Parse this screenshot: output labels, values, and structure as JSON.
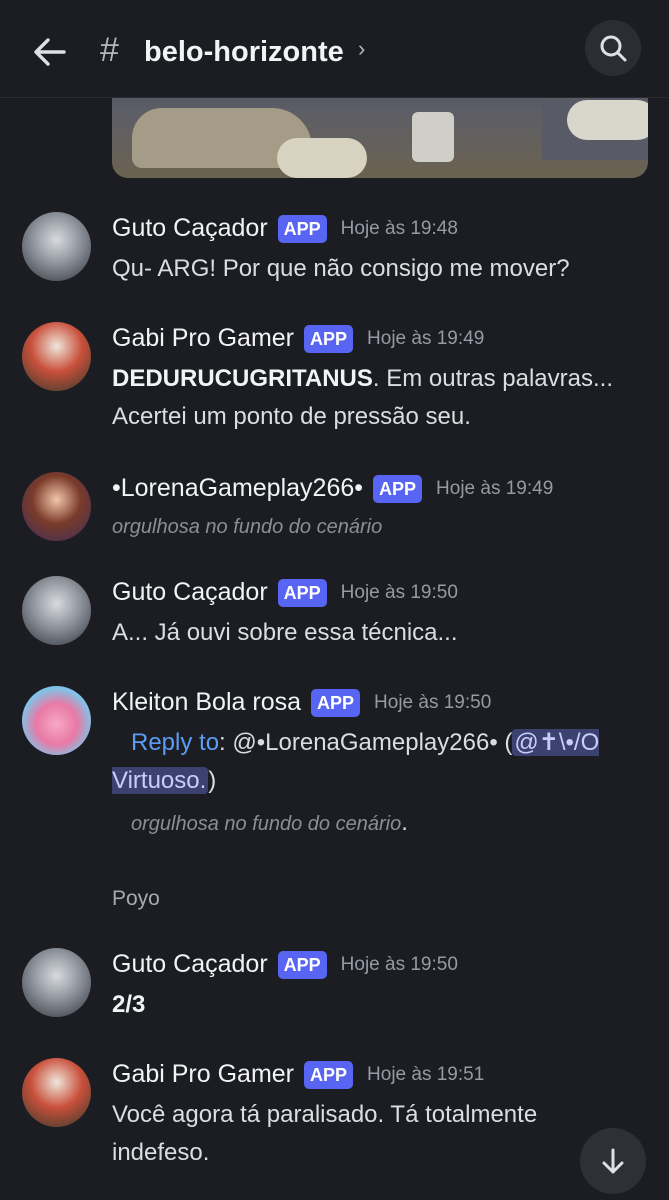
{
  "header": {
    "channel_name": "belo-horizonte",
    "hash_symbol": "#",
    "chevron": "›",
    "icons": [
      "back-arrow-icon",
      "search-icon"
    ]
  },
  "badge_label": "APP",
  "messages": [
    {
      "author": "Guto Caçador",
      "time": "Hoje às 19:48",
      "text": "Qu- ARG! Por que não consigo me mover?"
    },
    {
      "author": "Gabi Pro Gamer",
      "time": "Hoje às 19:49",
      "bold": "DEDURUCUGRITANUS",
      "text": ". Em outras palavras... Acertei um ponto de pressão seu."
    },
    {
      "author": "•LorenaGameplay266•",
      "time": "Hoje às 19:49",
      "text": "orgulhosa no fundo do cenário"
    },
    {
      "author": "Guto Caçador",
      "time": "Hoje às 19:50",
      "text": "A... Já ouvi sobre essa técnica..."
    },
    {
      "author": "Kleiton Bola rosa",
      "time": "Hoje às 19:50",
      "reply_label": "Reply to",
      "reply_colon": ": ",
      "reply_target": "@•LorenaGameplay266• (",
      "mention": "@✝\\•/O Virtuoso.",
      "reply_close": ")",
      "quote": "orgulhosa no fundo do cenário",
      "quote_end": ".",
      "followup": "Poyo"
    },
    {
      "author": "Guto Caçador",
      "time": "Hoje às 19:50",
      "text": "2/3"
    },
    {
      "author": "Gabi Pro Gamer",
      "time": "Hoje às 19:51",
      "text": "Você agora tá paralisado. Tá totalmente indefeso."
    }
  ]
}
